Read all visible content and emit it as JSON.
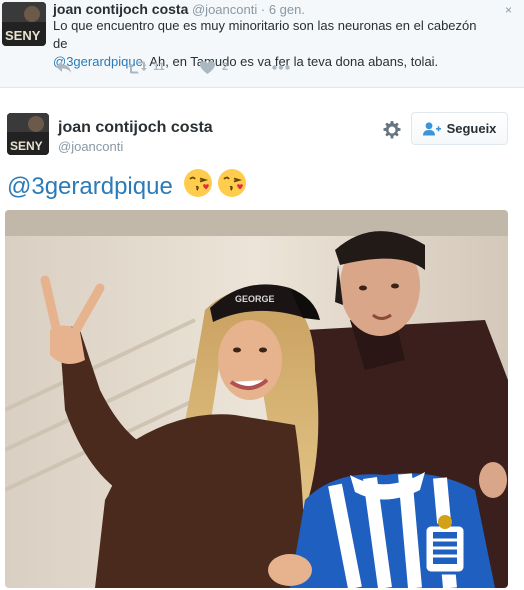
{
  "reply_tweet": {
    "name": "joan contijoch costa",
    "handle": "@joanconti",
    "dot": "·",
    "time": "6 gen.",
    "close_icon": "×",
    "text_line1": "Lo que encuentro que es muy minoritario son las neuronas en el cabezón de",
    "mention": "@3gerardpique",
    "text_line2": ". Ah, en Tamudo es va fer la teva dona abans, tolai.",
    "retweet_count": "11",
    "like_count": "2",
    "avatar_text": "SENY"
  },
  "main_tweet": {
    "name": "joan contijoch costa",
    "handle": "@joanconti",
    "follow_label": "Segueix",
    "mention": "@3gerardpique",
    "emojis": [
      "face-throwing-kiss",
      "face-throwing-kiss"
    ],
    "avatar_text": "SENY",
    "photo_description_visible_text": "",
    "cap_text": "GEORGE"
  },
  "colors": {
    "link": "#2b7bb9",
    "muted": "#8899a6",
    "icon": "#aab8c2",
    "text": "#292f33"
  }
}
